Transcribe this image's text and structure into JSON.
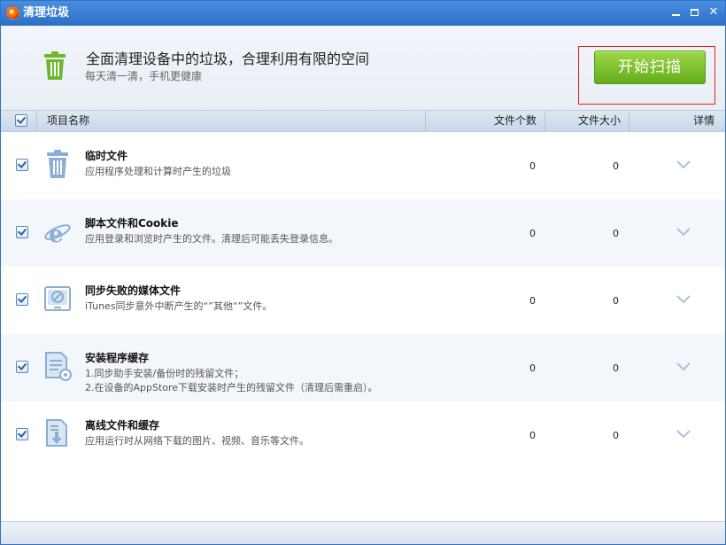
{
  "window": {
    "title": "清理垃圾"
  },
  "header": {
    "title": "全面清理设备中的垃圾，合理利用有限的空间",
    "subtitle": "每天清一清，手机更健康",
    "scan_button": "开始扫描"
  },
  "columns": {
    "name": "项目名称",
    "count": "文件个数",
    "size": "文件大小",
    "details": "详情"
  },
  "items": [
    {
      "title": "临时文件",
      "desc": "应用程序处理和计算时产生的垃圾",
      "count": "0",
      "size": "0",
      "icon": "trash-icon",
      "checked": true
    },
    {
      "title": "脚本文件和Cookie",
      "desc": "应用登录和浏览时产生的文件。清理后可能丢失登录信息。",
      "count": "0",
      "size": "0",
      "icon": "ie-browser-icon",
      "checked": true
    },
    {
      "title": "同步失败的媒体文件",
      "desc": "iTunes同步意外中断产生的“”其他“”文件。",
      "count": "0",
      "size": "0",
      "icon": "media-screen-icon",
      "checked": true
    },
    {
      "title": "安装程序缓存",
      "desc": "1.同步助手安装/备份时的残留文件；\n2.在设备的AppStore下载安装时产生的残留文件（清理后需重启）。",
      "count": "0",
      "size": "0",
      "icon": "installer-doc-icon",
      "checked": true
    },
    {
      "title": "离线文件和缓存",
      "desc": "应用运行时从网络下载的图片、视频、音乐等文件。",
      "count": "0",
      "size": "0",
      "icon": "download-doc-icon",
      "checked": true
    }
  ],
  "colors": {
    "titlebar": "#2c6fc6",
    "scan_button": "#7cc22e",
    "highlight_outline": "#e02020",
    "header_icon": "#6bb82a",
    "row_icon": "#8aaed4"
  }
}
